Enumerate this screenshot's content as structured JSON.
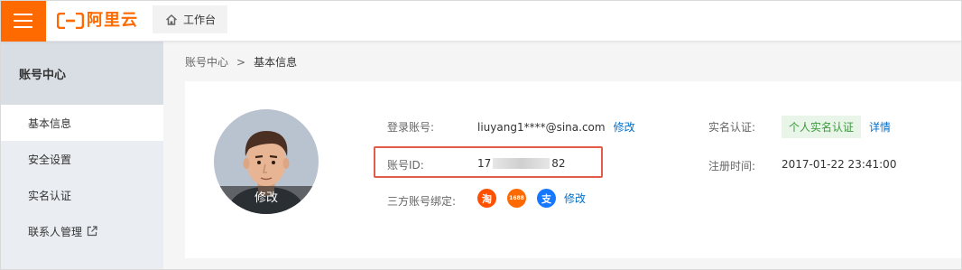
{
  "header": {
    "menu_icon": "hamburger-menu-icon",
    "logo_text": "阿里云",
    "brand_color": "#ff6a00",
    "workbench_label": "工作台"
  },
  "sidebar": {
    "title": "账号中心",
    "items": [
      {
        "label": "基本信息",
        "active": true
      },
      {
        "label": "安全设置",
        "active": false
      },
      {
        "label": "实名认证",
        "active": false
      },
      {
        "label": "联系人管理",
        "active": false,
        "external_icon": "external-link-icon"
      }
    ]
  },
  "breadcrumb": {
    "parent": "账号中心",
    "separator": ">",
    "current": "基本信息"
  },
  "profile": {
    "avatar_edit_label": "修改",
    "login_account_label": "登录账号:",
    "login_account_value": "liuyang1****@sina.com",
    "login_account_edit": "修改",
    "account_id_label": "账号ID:",
    "account_id_prefix": "17",
    "account_id_suffix": "82",
    "third_party_label": "三方账号绑定:",
    "third_party_accounts": [
      {
        "name": "taobao",
        "glyph": "淘",
        "color": "#ff5000"
      },
      {
        "name": "1688",
        "glyph": "1688",
        "color": "#ff6a00"
      },
      {
        "name": "alipay",
        "glyph": "支",
        "color": "#1677ff"
      }
    ],
    "third_party_edit": "修改",
    "realname_label": "实名认证:",
    "realname_badge": "个人实名认证",
    "realname_detail": "详情",
    "register_time_label": "注册时间:",
    "register_time_value": "2017-01-22 23:41:00",
    "highlight_color": "#e25c4a"
  }
}
